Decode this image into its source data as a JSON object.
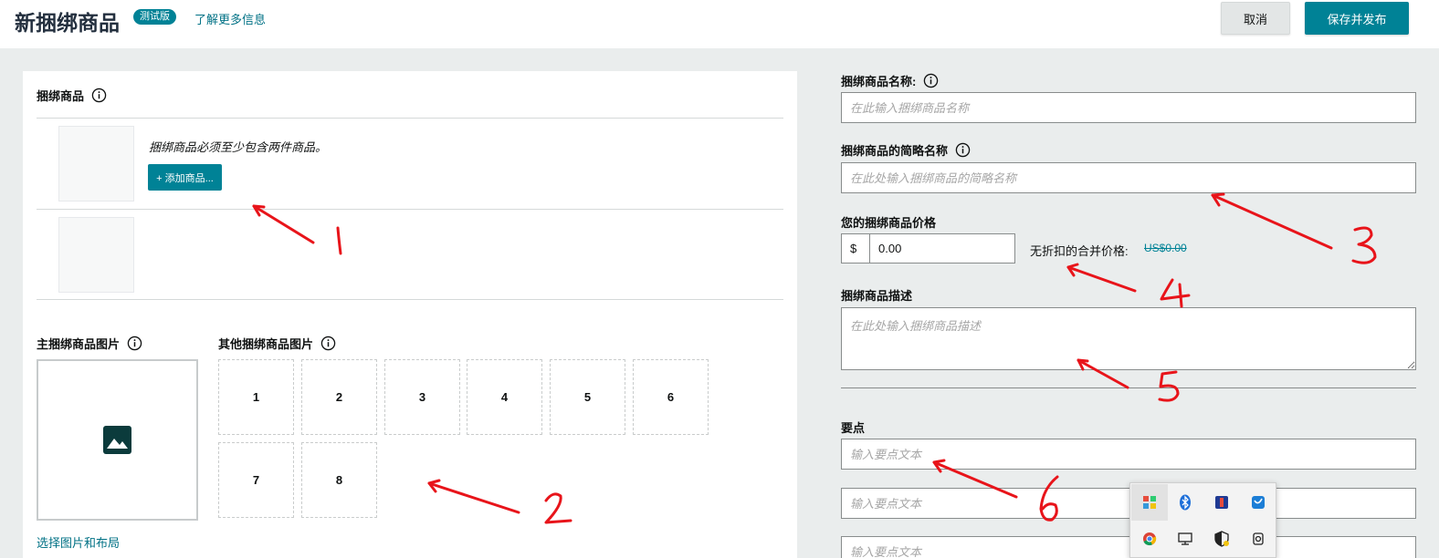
{
  "header": {
    "title": "新捆绑商品",
    "badge": "测试版",
    "learn_more": "了解更多信息",
    "cancel": "取消",
    "save_publish": "保存并发布"
  },
  "bundle_section": {
    "label": "捆绑商品",
    "note": "捆绑商品必须至少包含两件商品。",
    "add_button": "+ 添加商品..."
  },
  "images": {
    "main_label": "主捆绑商品图片",
    "other_label": "其他捆绑商品图片",
    "slots": [
      "1",
      "2",
      "3",
      "4",
      "5",
      "6",
      "7",
      "8"
    ],
    "select_link": "选择图片和布局"
  },
  "form": {
    "name_label": "捆绑商品名称:",
    "name_placeholder": "在此输入捆绑商品名称",
    "short_name_label": "捆绑商品的简略名称",
    "short_name_placeholder": "在此处输入捆绑商品的简略名称",
    "price_label": "您的捆绑商品价格",
    "currency": "$",
    "price_value": "0.00",
    "undiscounted_label": "无折扣的合并价格:",
    "undiscounted_value": "US$0.00",
    "desc_label": "捆绑商品描述",
    "desc_placeholder": "在此处输入捆绑商品描述",
    "key_points_label": "要点",
    "key_point_placeholder": "输入要点文本"
  },
  "annotations": [
    "1",
    "2",
    "3",
    "4",
    "5",
    "6"
  ],
  "tray_icons": [
    "app-grid-icon",
    "bluetooth-icon",
    "usb-device-icon",
    "network-app-icon",
    "chrome-icon",
    "display-icon",
    "security-shield-icon",
    "camera-icon"
  ],
  "colors": {
    "accent": "#008296",
    "link": "#007185",
    "annotation": "#e8141a"
  }
}
